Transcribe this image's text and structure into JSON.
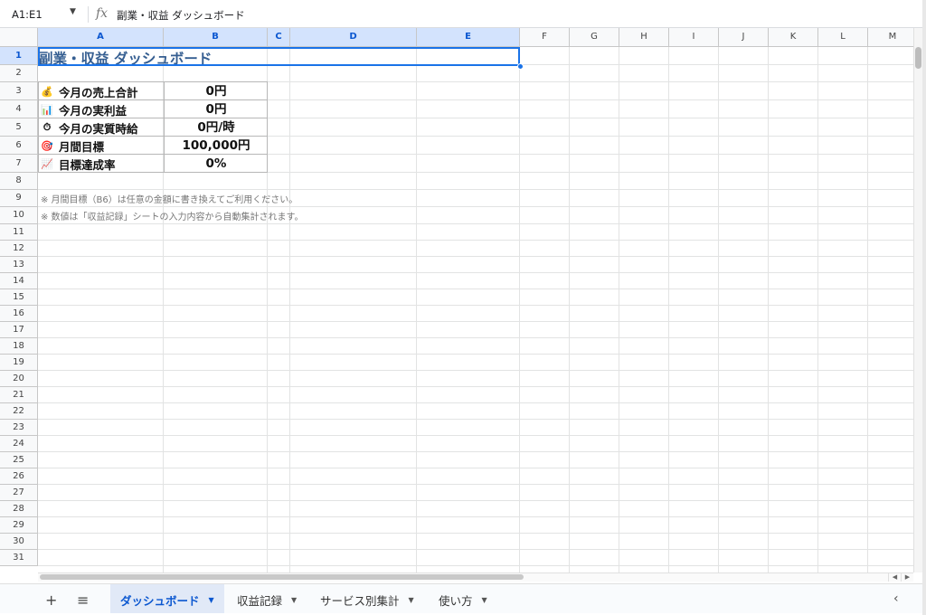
{
  "formula_bar": {
    "name_box": "A1:E1",
    "fx_symbol": "fx",
    "content": "副業・収益 ダッシュボード"
  },
  "columns": [
    "A",
    "B",
    "C",
    "D",
    "E",
    "F",
    "G",
    "H",
    "I",
    "J",
    "K",
    "L",
    "M"
  ],
  "rows": [
    "1",
    "2",
    "3",
    "4",
    "5",
    "6",
    "7",
    "8",
    "9",
    "10",
    "11",
    "12",
    "13",
    "14",
    "15",
    "16",
    "17",
    "18",
    "19",
    "20",
    "21",
    "22",
    "23",
    "24",
    "25",
    "26",
    "27",
    "28",
    "29",
    "30",
    "31"
  ],
  "sheet": {
    "title": "副業・収益 ダッシュボード",
    "kpis": [
      {
        "icon": "money-bag-icon",
        "glyph": "💰",
        "label": "今月の売上合計",
        "value": "0円"
      },
      {
        "icon": "bar-chart-icon",
        "glyph": "📊",
        "label": "今月の実利益",
        "value": "0円"
      },
      {
        "icon": "stopwatch-icon",
        "glyph": "⏱",
        "label": "今月の実質時給",
        "value": "0円/時"
      },
      {
        "icon": "target-icon",
        "glyph": "🎯",
        "label": "月間目標",
        "value": "100,000円"
      },
      {
        "icon": "trend-chart-icon",
        "glyph": "📈",
        "label": "目標達成率",
        "value": "0%"
      }
    ],
    "notes": [
      "※ 月間目標（B6）は任意の金額に書き換えてご利用ください。",
      "※ 数値は「収益記録」シートの入力内容から自動集計されます。"
    ]
  },
  "tabs": [
    {
      "label": "ダッシュボード",
      "active": true
    },
    {
      "label": "収益記録",
      "active": false
    },
    {
      "label": "サービス別集計",
      "active": false
    },
    {
      "label": "使い方",
      "active": false
    }
  ],
  "colors": {
    "accent": "#1a73e8",
    "title": "#355e91",
    "selected_header": "#d3e3fd"
  }
}
